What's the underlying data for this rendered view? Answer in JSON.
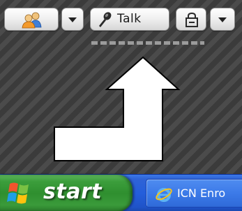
{
  "toolbar": {
    "contacts_icon": "contacts-icon",
    "dropdown_icon": "chevron-down-icon",
    "talk_icon": "microphone-icon",
    "talk_label": "Talk",
    "lock_icon": "lock-icon"
  },
  "pointer": {
    "icon": "arrow-up-icon",
    "color": "#ffffff"
  },
  "taskbar": {
    "start_label": "start",
    "start_icon": "windows-flag-icon",
    "task_item_icon": "internet-explorer-icon",
    "task_item_label": "ICN Enro",
    "start_color": "#3c9e3c",
    "taskbar_color": "#245edb"
  }
}
